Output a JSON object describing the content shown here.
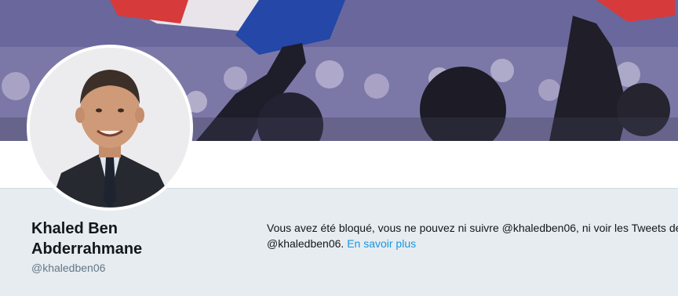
{
  "profile": {
    "name_line1": "Khaled Ben",
    "name_line2": "Abderrahmane",
    "handle": "@khaledben06"
  },
  "blocked_notice": {
    "line1": "Vous avez été bloqué, vous ne pouvez ni suivre @khaledben06, ni voir les Tweets de",
    "line2_prefix": "@khaledben06.",
    "learn_more": "En savoir plus"
  },
  "colors": {
    "page_background": "#e6ecf0",
    "link": "#1b95e0",
    "text_primary": "#14171a",
    "text_secondary": "#657786"
  }
}
